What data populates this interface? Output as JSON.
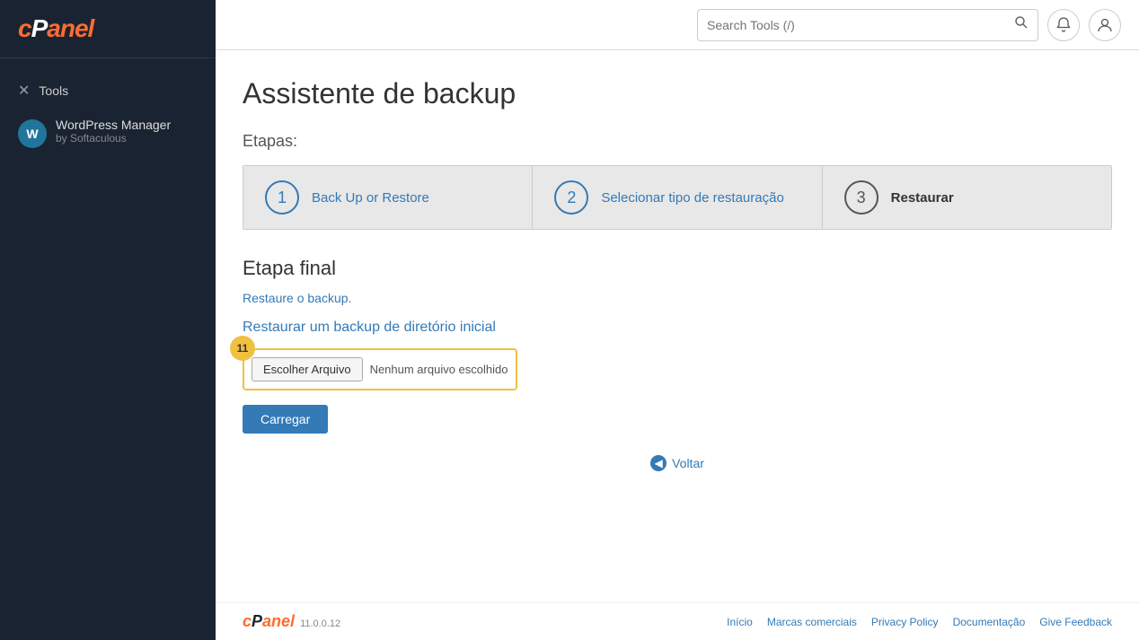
{
  "sidebar": {
    "logo": "cPanel",
    "logo_color": "#ff6c2f",
    "items": [
      {
        "id": "tools",
        "label": "Tools",
        "icon": "✕"
      }
    ],
    "wordpress": {
      "title": "WordPress Manager",
      "subtitle": "by Softaculous",
      "icon": "W"
    }
  },
  "header": {
    "search": {
      "placeholder": "Search Tools (/)",
      "value": ""
    },
    "icons": {
      "bell": "🔔",
      "user": "👤"
    }
  },
  "main": {
    "page_title": "Assistente de backup",
    "steps_label": "Etapas:",
    "steps": [
      {
        "number": "1",
        "label": "Back Up or Restore",
        "state": "active"
      },
      {
        "number": "2",
        "label": "Selecionar tipo de restauração",
        "state": "active"
      },
      {
        "number": "3",
        "label": "Restaurar",
        "state": "current"
      }
    ],
    "section_title": "Etapa final",
    "restore_text": "Restaure o backup.",
    "restore_section_title": "Restaurar um backup de diretório inicial",
    "file_button_label": "Escolher Arquivo",
    "file_placeholder": "Nenhum arquivo escolhido",
    "upload_button_label": "Carregar",
    "step_badge": "11",
    "back_link": "Voltar"
  },
  "footer": {
    "logo": "cPanel",
    "version": "11.0.0.12",
    "links": [
      {
        "label": "Início"
      },
      {
        "label": "Marcas comerciais"
      },
      {
        "label": "Privacy Policy"
      },
      {
        "label": "Documentação"
      },
      {
        "label": "Give Feedback"
      }
    ]
  }
}
